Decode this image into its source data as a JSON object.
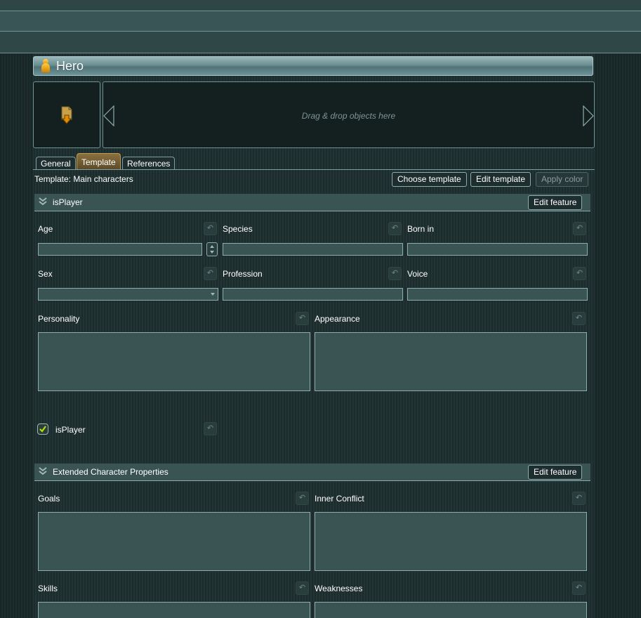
{
  "window": {
    "title": "Hero"
  },
  "media": {
    "drop_hint": "Drag & drop objects here"
  },
  "tabs": [
    {
      "label": "General",
      "active": false
    },
    {
      "label": "Template",
      "active": true
    },
    {
      "label": "References",
      "active": false
    }
  ],
  "template": {
    "label": "Template: Main characters",
    "choose_label": "Choose template",
    "edit_label": "Edit template",
    "apply_color_label": "Apply color"
  },
  "sections": {
    "isplayer": {
      "title": "isPlayer",
      "edit_label": "Edit feature",
      "fields": {
        "age": "Age",
        "species": "Species",
        "born_in": "Born in",
        "sex": "Sex",
        "profession": "Profession",
        "voice": "Voice",
        "personality": "Personality",
        "appearance": "Appearance",
        "isplayer_check": "isPlayer"
      },
      "isplayer_checked": true
    },
    "extended": {
      "title": "Extended Character Properties",
      "edit_label": "Edit feature",
      "fields": {
        "goals": "Goals",
        "inner_conflict": "Inner Conflict",
        "skills": "Skills",
        "weaknesses": "Weaknesses"
      }
    }
  },
  "colors": {
    "accent": "#c09a50",
    "check": "#b4e000",
    "panel": "#3a5454"
  },
  "icons": {
    "entity": "pawn-icon",
    "reset": "undo-icon",
    "collapse": "chevron-down-icon"
  }
}
